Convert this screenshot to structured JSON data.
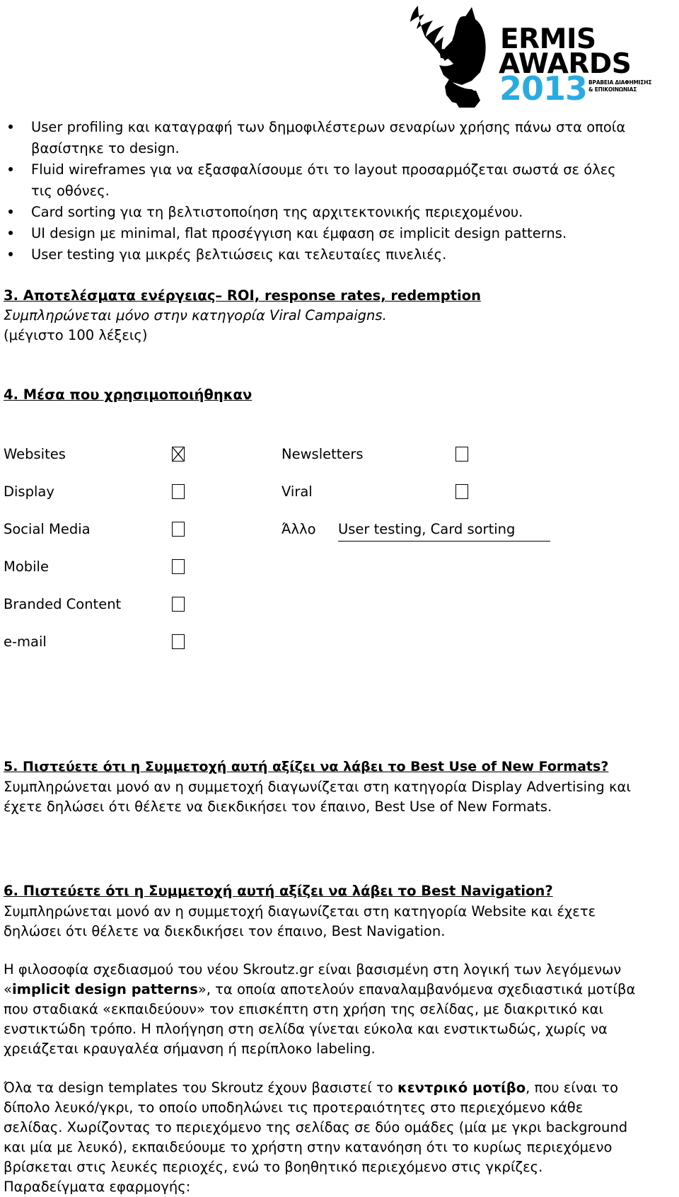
{
  "logo": {
    "name": "ermis-awards-2013-logo",
    "line1": "ERMIS",
    "line2": "AWARDS",
    "year": "2013",
    "subtitle": "ΒΡΑΒΕΙΑ ΔΙΑΦΗΜΙΣΗΣ & ΕΠΙΚΟΙΝΩΝΙΑΣ",
    "year_color": "#29ABE2",
    "text_color": "#000000"
  },
  "bullets": [
    "User profiling και καταγραφή των δημοφιλέστερων σεναρίων χρήσης πάνω στα οποία βασίστηκε το design.",
    "Fluid wireframes για να εξασφαλίσουμε ότι το layout προσαρμόζεται σωστά σε όλες τις οθόνες.",
    "Card sorting για τη βελτιστοποίηση της αρχιτεκτονικής περιεχομένου.",
    "UI design με minimal, flat προσέγγιση και έμφαση σε implicit design patterns.",
    "User testing για μικρές βελτιώσεις και τελευταίες πινελιές."
  ],
  "section3": {
    "heading": "3. Αποτελέσματα ενέργειας– ROI, response rates, redemption",
    "note_italic": "Συμπληρώνεται μόνο στην κατηγορία Viral Campaigns.",
    "note_limit": "(μέγιστο 100 λέξεις)"
  },
  "section4": {
    "heading": "4. Μέσα που χρησιμοποιήθηκαν",
    "rows": [
      {
        "left_label": "Websites",
        "left_checked": true,
        "right_label": "Newsletters",
        "right_checked": false,
        "right_type": "checkbox"
      },
      {
        "left_label": "Display",
        "left_checked": false,
        "right_label": "Viral",
        "right_checked": false,
        "right_type": "checkbox"
      },
      {
        "left_label": "Social Media",
        "left_checked": false,
        "right_label": "Άλλο",
        "right_type": "text",
        "right_value": "User testing, Card sorting"
      },
      {
        "left_label": "Mobile",
        "left_checked": false,
        "right_label": "",
        "right_type": "none"
      },
      {
        "left_label": "Branded Content",
        "left_checked": false,
        "right_label": "",
        "right_type": "none"
      },
      {
        "left_label": "e-mail",
        "left_checked": false,
        "right_label": "",
        "right_type": "none"
      }
    ]
  },
  "section5": {
    "heading": "5. Πιστεύετε ότι η Συμμετοχή αυτή αξίζει να λάβει το Best Use of New Formats?",
    "body": "Συμπληρώνεται μονό αν η συμμετοχή διαγωνίζεται στη κατηγορία Display Advertising και έχετε δηλώσει ότι θέλετε να διεκδικήσει τον έπαινο, Best Use of New Formats."
  },
  "section6": {
    "heading": "6. Πιστεύετε ότι η Συμμετοχή αυτή αξίζει να λάβει το Best Navigation?",
    "body": "Συμπληρώνεται μονό αν η συμμετοχή διαγωνίζεται στη κατηγορία Website και έχετε δηλώσει ότι θέλετε να διεκδικήσει τον έπαινο, Best Navigation."
  },
  "paragraphs": {
    "p1_part1": "Η φιλοσοφία σχεδιασμού του νέου Skroutz.gr είναι βασισμένη στη λογική των λεγόμενων «",
    "p1_bold": "implicit design patterns",
    "p1_part2": "», τα οποία αποτελούν επαναλαμβανόμενα σχεδιαστικά μοτίβα που σταδιακά «εκπαιδεύουν» τον επισκέπτη στη χρήση της σελίδας, με διακριτικό και ενστικτώδη τρόπο. Η πλοήγηση στη σελίδα γίνεται εύκολα και ενστικτωδώς, χωρίς να χρειάζεται κραυγαλέα σήμανση ή περίπλοκο labeling.",
    "p2_part1": "Όλα τα design templates του Skroutz έχουν βασιστεί το ",
    "p2_bold": "κεντρικό μοτίβο",
    "p2_part2": ", που είναι το δίπολο λευκό/γκρι, το οποίο υποδηλώνει τις προτεραιότητες στο περιεχόμενο κάθε σελίδας. Χωρίζοντας το περιεχόμενο της σελίδας σε δύο ομάδες (μία με γκρι background και μία με λευκό), εκπαιδεύουμε το χρήστη στην κατανόηση ότι το κυρίως περιεχόμενο βρίσκεται στις λευκές περιοχές, ενώ το βοηθητικό περιεχόμενο στις γκρίζες. Παραδείγματα εφαρμογής:"
  }
}
